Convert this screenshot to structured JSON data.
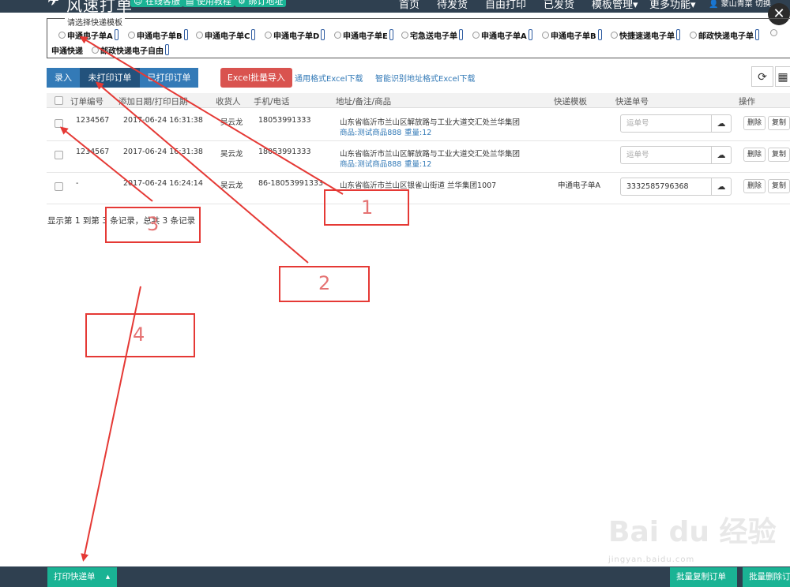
{
  "header": {
    "app_title": "风速打单",
    "buttons": [
      "在线客服",
      "使用教程",
      "绑订地址"
    ],
    "nav": [
      "首页",
      "待发货",
      "自由打印",
      "已发货",
      "模板管理▾",
      "更多功能▾"
    ],
    "user": "蒙山青菜 切换",
    "close": "✕"
  },
  "template_selector": {
    "legend": "请选择快递模板",
    "options": [
      "申通电子单A",
      "申通电子单B",
      "申通电子单C",
      "申通电子单D",
      "申通电子单E",
      "宅急送电子单",
      "申通电子单A",
      "申通电子单B",
      "快捷速递电子单",
      "邮政快递电子单",
      "申通快递",
      "邮政快递电子自由"
    ]
  },
  "toolbar": {
    "tabs": [
      "录入",
      "未打印订单",
      "已打印订单"
    ],
    "excel_button": "Excel批量导入",
    "links": [
      "通用格式Excel下载",
      "智能识别地址格式Excel下载"
    ],
    "refresh_icon": "refresh-icon",
    "grid_icon": "grid-icon"
  },
  "table": {
    "columns": [
      "订单编号",
      "添加日期/打印日期",
      "收货人",
      "手机/电话",
      "地址/备注/商品",
      "快递模板",
      "快递单号",
      "操作"
    ],
    "rows": [
      {
        "order_no": "1234567",
        "date": "2017-06-24 16:31:38",
        "receiver": "吴云龙",
        "phone": "18053991333",
        "address": "山东省临沂市兰山区解放路与工业大道交汇处兰华集团",
        "goods": "商品:测试商品888",
        "weight": "重量:12",
        "template": "",
        "tracking_value": "",
        "tracking_placeholder": "运单号"
      },
      {
        "order_no": "1234567",
        "date": "2017-06-24 16:31:38",
        "receiver": "吴云龙",
        "phone": "18053991333",
        "address": "山东省临沂市兰山区解放路与工业大道交汇处兰华集团",
        "goods": "商品:测试商品888",
        "weight": "重量:12",
        "template": "",
        "tracking_value": "",
        "tracking_placeholder": "运单号"
      },
      {
        "order_no": "-",
        "date": "2017-06-24 16:24:14",
        "receiver": "吴云龙",
        "phone": "86-18053991333",
        "address": "山东省临沂市兰山区银雀山街道 兰华集团1007",
        "goods": "",
        "weight": "",
        "template": "申通电子单A",
        "tracking_value": "3332585796368",
        "tracking_placeholder": "运单号"
      }
    ],
    "actions": [
      "删除",
      "复制"
    ]
  },
  "summary": "显示第 1 到第 3 条记录，总共 3 条记录",
  "bottom": {
    "print_button": "打印快递单",
    "caret": "▴",
    "batch_copy": "批量复制订单",
    "batch_delete": "批量删除订单"
  },
  "annotations": [
    "1",
    "2",
    "3",
    "4"
  ],
  "watermark": {
    "logo": "Bai du 经验",
    "url": "jingyan.baidu.com"
  },
  "colors": {
    "header_bg": "#2f4050",
    "accent_green": "#1ab394",
    "tab_blue": "#337ab7",
    "excel_red": "#d9534f",
    "annotation_red": "#e53935"
  }
}
